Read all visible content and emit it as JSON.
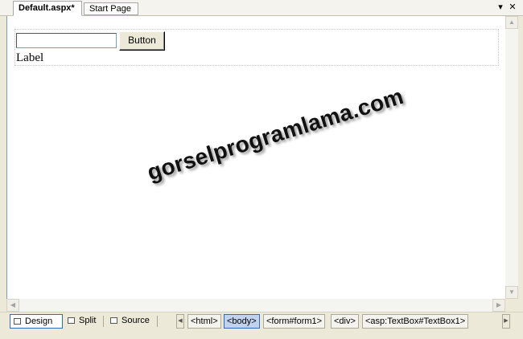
{
  "tabs": [
    {
      "label": "Default.aspx*",
      "active": true
    },
    {
      "label": "Start Page",
      "active": false
    }
  ],
  "window_controls": {
    "dropdown": "▾",
    "close": "✕"
  },
  "design_surface": {
    "textbox_value": "",
    "button_label": "Button",
    "label_text": "Label",
    "watermark": "gorselprogramlama.com"
  },
  "view_modes": [
    {
      "label": "Design",
      "active": true
    },
    {
      "label": "Split",
      "active": false
    },
    {
      "label": "Source",
      "active": false
    }
  ],
  "breadcrumbs": [
    {
      "label": "<html>",
      "active": false
    },
    {
      "label": "<body>",
      "active": true
    },
    {
      "label": "<form#form1>",
      "active": false
    },
    {
      "label": "<div>",
      "active": false
    },
    {
      "label": "<asp:TextBox#TextBox1>",
      "active": false
    }
  ],
  "icons": {
    "scroll_up": "▲",
    "scroll_down": "▼",
    "scroll_left": "◀",
    "scroll_right": "▶",
    "nav_left": "◀",
    "nav_right": "▶"
  }
}
